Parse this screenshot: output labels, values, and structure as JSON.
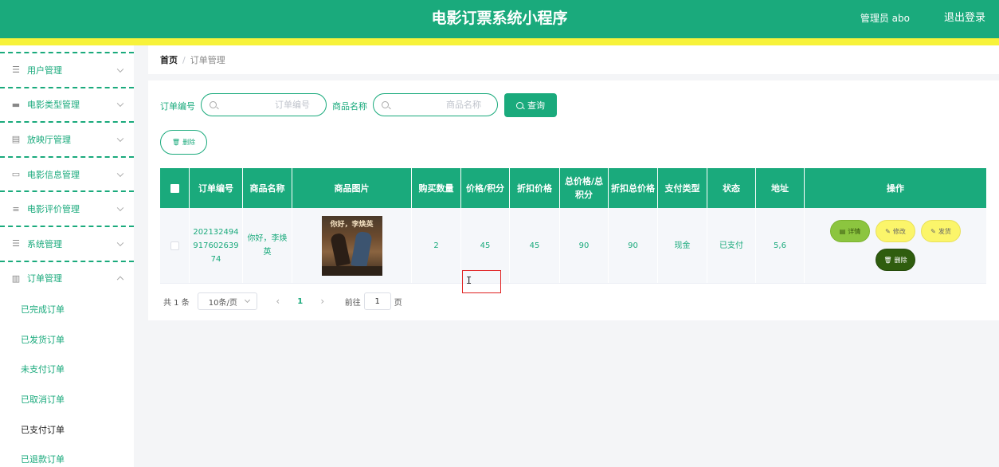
{
  "header": {
    "title": "电影订票系统小程序",
    "user": "管理员 abo",
    "logout": "退出登录"
  },
  "sidebar": {
    "menus": [
      {
        "label": "用户管理",
        "icon": "list-icon"
      },
      {
        "label": "电影类型管理",
        "icon": "briefcase-icon"
      },
      {
        "label": "放映厅管理",
        "icon": "document-icon"
      },
      {
        "label": "电影信息管理",
        "icon": "monitor-icon"
      },
      {
        "label": "电影评价管理",
        "icon": "sliders-icon"
      },
      {
        "label": "系统管理",
        "icon": "menu-icon"
      },
      {
        "label": "订单管理",
        "icon": "clipboard-icon"
      }
    ],
    "order_submenu": [
      "已完成订单",
      "已发货订单",
      "未支付订单",
      "已取消订单",
      "已支付订单",
      "已退款订单"
    ]
  },
  "breadcrumb": {
    "home": "首页",
    "separator": "/",
    "current": "订单管理"
  },
  "search": {
    "order_no_label": "订单编号",
    "order_no_placeholder": "订单编号",
    "product_name_label": "商品名称",
    "product_name_placeholder": "商品名称",
    "query_button": "查询"
  },
  "toolbar": {
    "delete_button": "删除"
  },
  "table": {
    "headers": [
      "订单编号",
      "商品名称",
      "商品图片",
      "购买数量",
      "价格/积分",
      "折扣价格",
      "总价格/总积分",
      "折扣总价格",
      "支付类型",
      "状态",
      "地址",
      "操作"
    ],
    "rows": [
      {
        "order_no": "20213249491760263974",
        "product_name": "你好，李焕英",
        "image_caption": "你好，李焕英",
        "quantity": "2",
        "price": "45",
        "discount_price": "45",
        "total_price": "90",
        "discount_total": "90",
        "pay_type": "现金",
        "status": "已支付",
        "address": "5,6",
        "actions": {
          "detail": "详情",
          "edit": "修改",
          "ship": "发货",
          "delete": "删除"
        }
      }
    ]
  },
  "pagination": {
    "total": "共 1 条",
    "page_size": "10条/页",
    "current_page": "1",
    "goto_label": "前往",
    "goto_value": "1",
    "page_suffix": "页"
  },
  "colors": {
    "primary": "#1aaa7c",
    "stripe": "#f7f23a",
    "detail_btn": "#8cc53f",
    "edit_btn": "#fbf56a",
    "delete_btn": "#2f5d0e"
  }
}
